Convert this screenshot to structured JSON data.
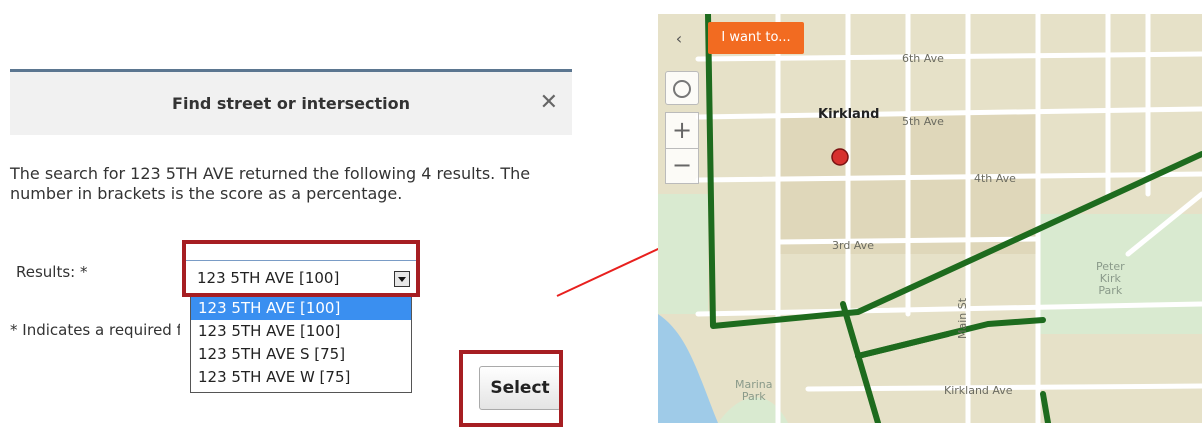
{
  "dialog": {
    "title": "Find street or intersection",
    "close_icon": "✕",
    "description": "The search for 123 5TH AVE returned the following 4 results. The number in brackets is the score as a percentage.",
    "results_label": "Results: *",
    "selected_value": "123 5TH AVE [100]",
    "options": [
      "123 5TH AVE [100]",
      "123 5TH AVE [100]",
      "123 5TH AVE S [75]",
      "123 5TH AVE W [75]"
    ],
    "required_note": "* Indicates a required field",
    "select_button": "Select",
    "highlight_color": "#a61e22"
  },
  "map": {
    "collapse_icon": "‹",
    "i_want_to_button": "I want to...",
    "zoom_in_icon": "+",
    "zoom_out_icon": "−",
    "locate_icon": "locate-icon",
    "city_label": "Kirkland",
    "street_labels": [
      "6th Ave",
      "5th Ave",
      "4th Ave",
      "3rd Ave",
      "Kirkland Ave",
      "Main St"
    ],
    "parks": {
      "peter_kirk": [
        "Peter",
        "Kirk",
        "Park"
      ],
      "marina": [
        "Marina",
        "Park"
      ]
    },
    "route_color": "#1e6b1e",
    "marker_color": "#d7312e"
  },
  "annotation": {
    "arrow_color": "#e8201e"
  }
}
